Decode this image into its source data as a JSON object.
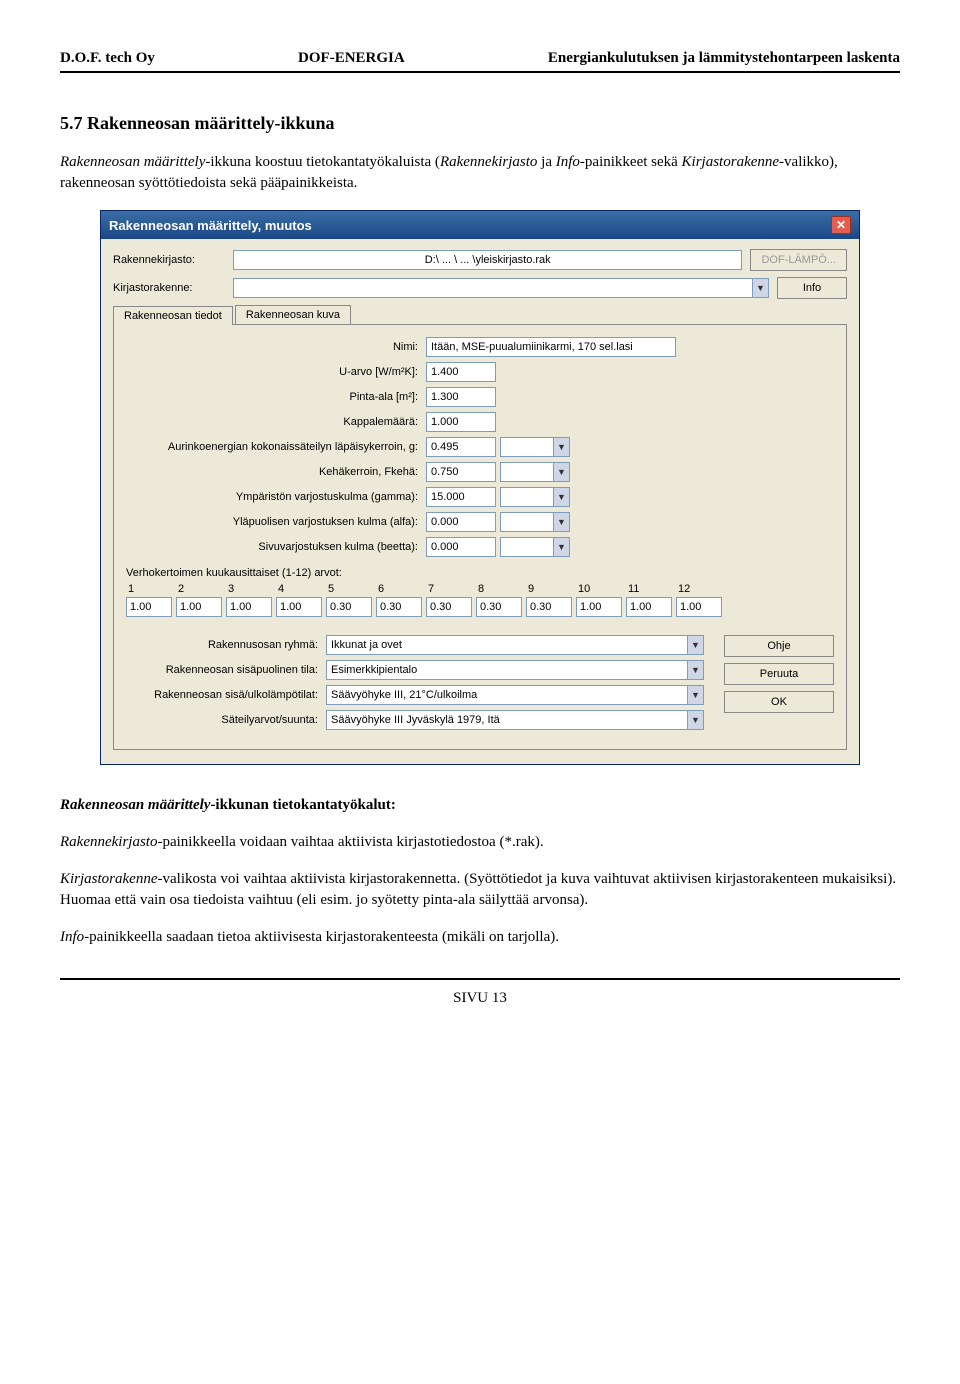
{
  "header": {
    "left": "D.O.F. tech Oy",
    "center": "DOF-ENERGIA",
    "right": "Energiankulutuksen ja lämmitystehontarpeen laskenta"
  },
  "section_title": "5.7 Rakenneosan määrittely-ikkuna",
  "intro_para": {
    "t1": "Rakenneosan määrittely",
    "t2": "-ikkuna koostuu tietokantatyökaluista (",
    "t3": "Rakennekirjasto",
    "t4": " ja ",
    "t5": "Info",
    "t6": "-painikkeet sekä ",
    "t7": "Kirjastorakenne",
    "t8": "-valikko), rakenneosan syöttötiedoista sekä pääpainikkeista."
  },
  "dialog": {
    "title": "Rakenneosan määrittely, muutos",
    "label_rakennekirjasto": "Rakennekirjasto:",
    "path": "D:\\ ... \\ ... \\yleiskirjasto.rak",
    "btn_dof": "DOF-LÄMPÖ...",
    "label_kirjastorakenne": "Kirjastorakenne:",
    "btn_info": "Info",
    "tab_tiedot": "Rakenneosan tiedot",
    "tab_kuva": "Rakenneosan kuva",
    "fields": {
      "nimi_label": "Nimi:",
      "nimi_val": "Itään, MSE-puualumiinikarmi, 170 sel.lasi",
      "uarvo_label": "U-arvo [W/m²K]:",
      "uarvo_val": "1.400",
      "pinta_label": "Pinta-ala [m²]:",
      "pinta_val": "1.300",
      "kpl_label": "Kappalemäärä:",
      "kpl_val": "1.000",
      "g_label": "Aurinkoenergian kokonaissäteilyn läpäisykerroin, g:",
      "g_val": "0.495",
      "fkeha_label": "Kehäkerroin, Fkehä:",
      "fkeha_val": "0.750",
      "gamma_label": "Ympäristön varjostuskulma (gamma):",
      "gamma_val": "15.000",
      "alfa_label": "Yläpuolisen varjostuksen kulma (alfa):",
      "alfa_val": "0.000",
      "beetta_label": "Sivuvarjostuksen kulma (beetta):",
      "beetta_val": "0.000"
    },
    "verho_label": "Verhokertoimen kuukausittaiset (1-12) arvot:",
    "months": [
      "1",
      "2",
      "3",
      "4",
      "5",
      "6",
      "7",
      "8",
      "9",
      "10",
      "11",
      "12"
    ],
    "month_vals": [
      "1.00",
      "1.00",
      "1.00",
      "1.00",
      "0.30",
      "0.30",
      "0.30",
      "0.30",
      "0.30",
      "1.00",
      "1.00",
      "1.00"
    ],
    "bottom": {
      "ryhma_label": "Rakennusosan ryhmä:",
      "ryhma_val": "Ikkunat ja ovet",
      "sisatila_label": "Rakenneosan sisäpuolinen tila:",
      "sisatila_val": "Esimerkkipientalo",
      "sisuulko_label": "Rakenneosan sisä/ulkolämpötilat:",
      "sisuulko_val": "Säävyöhyke III, 21°C/ulkoilma",
      "sateily_label": "Säteilyarvot/suunta:",
      "sateily_val": "Säävyöhyke III Jyväskylä 1979, Itä"
    },
    "btn_ohje": "Ohje",
    "btn_peruuta": "Peruuta",
    "btn_ok": "OK"
  },
  "after1_heading": {
    "t1": "Rakenneosan määrittely",
    "t2": "-ikkunan tietokantatyökalut:"
  },
  "after2": {
    "t1": "Rakennekirjasto",
    "t2": "-painikkeella voidaan vaihtaa aktiivista kirjastotiedostoa (*.rak)."
  },
  "after3": {
    "t1": "Kirjastorakenne",
    "t2": "-valikosta voi vaihtaa aktiivista kirjastorakennetta. (Syöttötiedot ja kuva vaihtuvat aktiivisen kirjastorakenteen mukaisiksi). Huomaa että vain osa tiedoista vaihtuu (eli esim. jo syötetty pinta-ala säilyttää arvonsa)."
  },
  "after4": {
    "t1": "Info",
    "t2": "-painikkeella saadaan tietoa aktiivisesta kirjastorakenteesta (mikäli on tarjolla)."
  },
  "footer": "SIVU 13"
}
